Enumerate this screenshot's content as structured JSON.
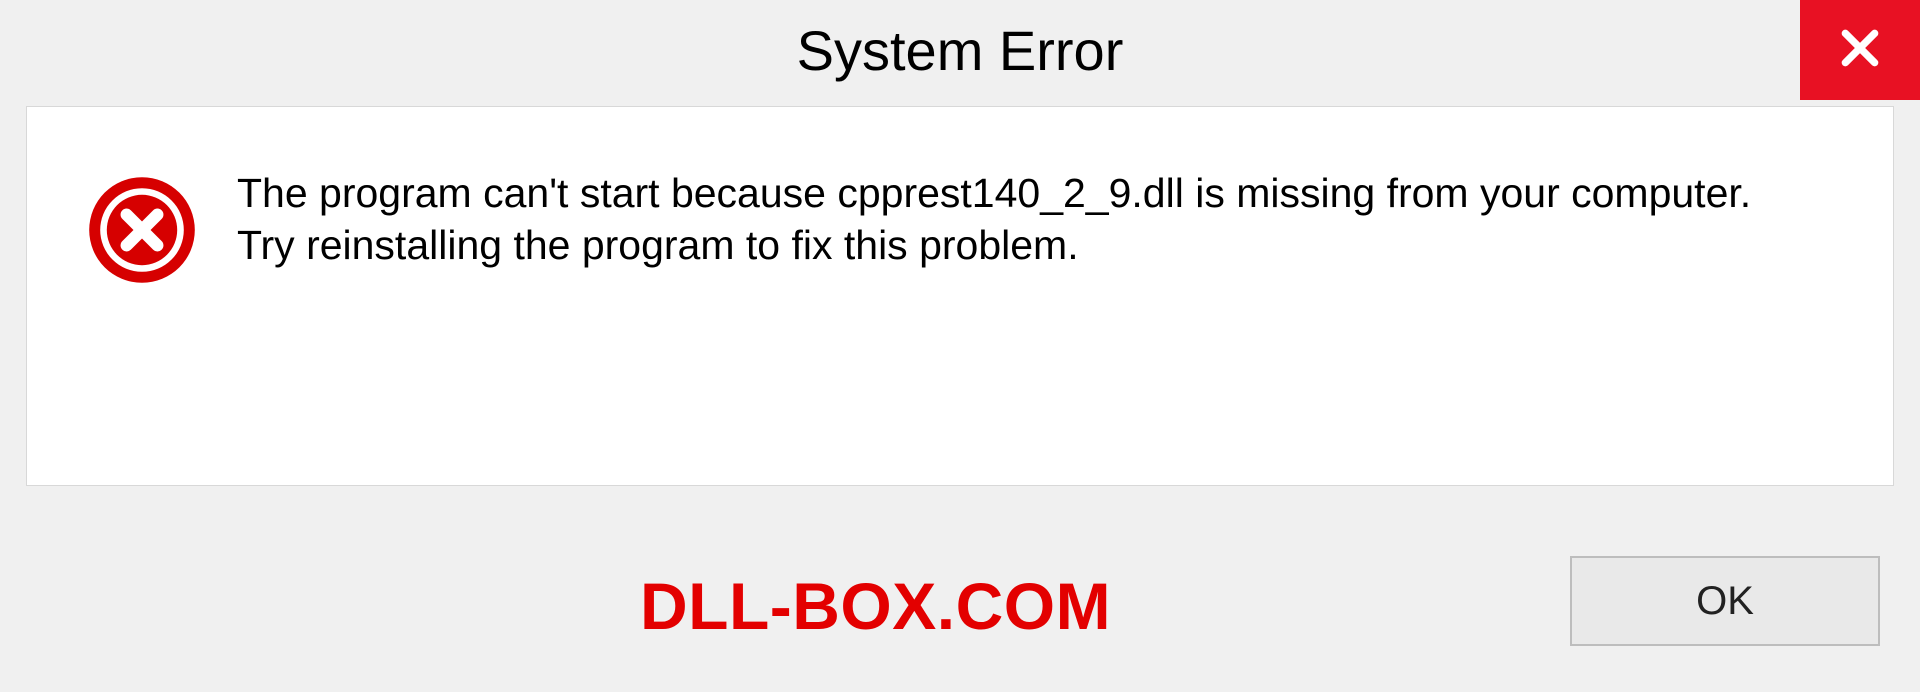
{
  "titlebar": {
    "title": "System Error"
  },
  "body": {
    "message": "The program can't start because cpprest140_2_9.dll is missing from your computer. Try reinstalling the program to fix this problem."
  },
  "footer": {
    "watermark": "DLL-BOX.COM",
    "ok_label": "OK"
  },
  "icons": {
    "close": "close-icon",
    "error": "error-circle-x-icon"
  },
  "colors": {
    "close_bg": "#e81123",
    "error_icon": "#d60000",
    "watermark": "#e30000"
  }
}
